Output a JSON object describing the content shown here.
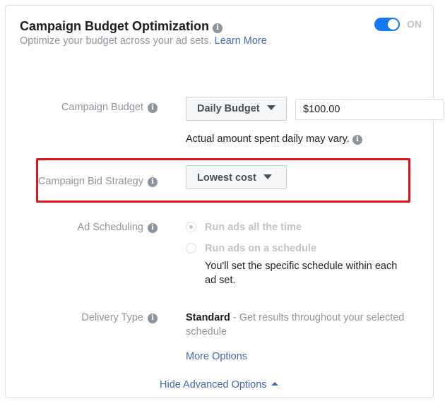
{
  "header": {
    "title": "Campaign Budget Optimization",
    "subtitle": "Optimize your budget across your ad sets.",
    "learn_more": "Learn More",
    "toggle_label": "ON",
    "toggle_on": true
  },
  "budget": {
    "label": "Campaign Budget",
    "dropdown": "Daily Budget",
    "amount": "$100.00",
    "note": "Actual amount spent daily may vary."
  },
  "bid": {
    "label": "Campaign Bid Strategy",
    "dropdown": "Lowest cost",
    "highlight_color": "#e0131c"
  },
  "scheduling": {
    "label": "Ad Scheduling",
    "options": [
      {
        "label": "Run ads all the time",
        "selected": true
      },
      {
        "label": "Run ads on a schedule",
        "selected": false
      }
    ],
    "description_line1": "You'll set the specific schedule within each",
    "description_line2": "ad set."
  },
  "delivery": {
    "label": "Delivery Type",
    "type": "Standard",
    "description": " - Get results throughout your selected",
    "description_line2": "schedule",
    "more_options": "More Options"
  },
  "footer": {
    "hide_advanced": "Hide Advanced Options"
  },
  "icons": {
    "info": "info-icon",
    "dropdown": "caret-down-icon",
    "collapse": "caret-up-icon"
  }
}
